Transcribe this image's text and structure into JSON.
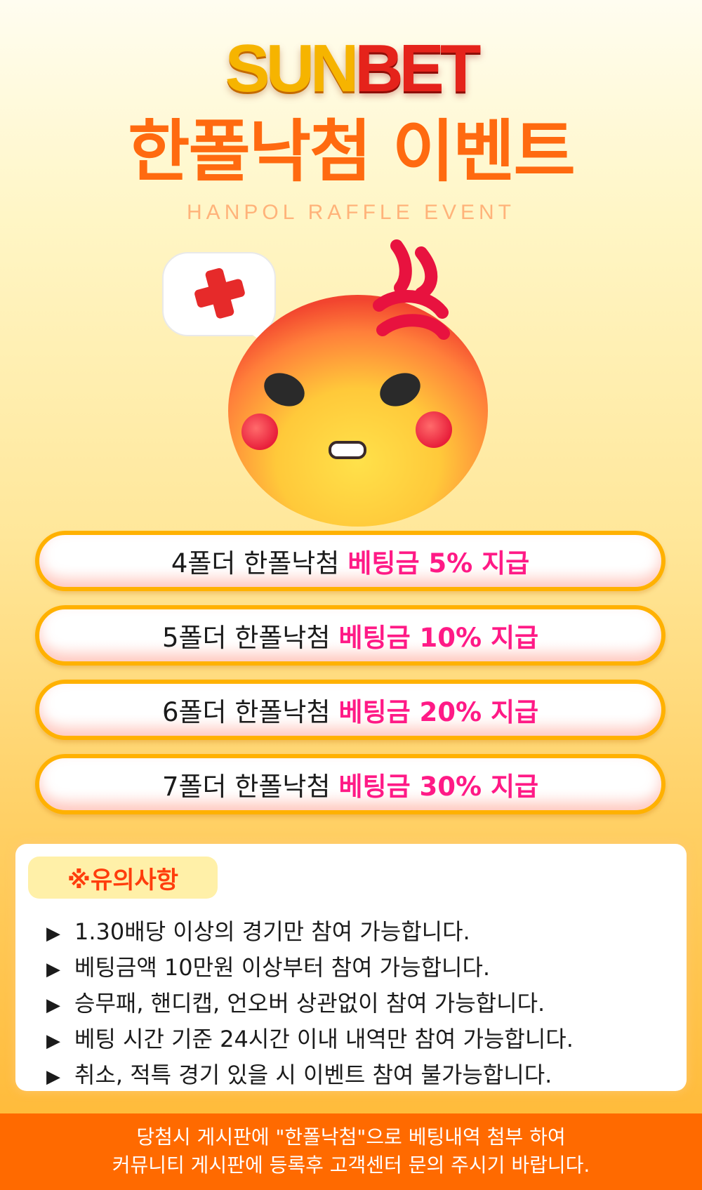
{
  "logo": {
    "part1": "SUN",
    "part2": "BET"
  },
  "title": "한폴낙첨 이벤트",
  "subtitle": "HANPOL RAFFLE EVENT",
  "tiers": [
    {
      "prefix": "4폴더 한폴낙첨",
      "highlight": "베팅금 5% 지급"
    },
    {
      "prefix": "5폴더 한폴낙첨",
      "highlight": "베팅금 10% 지급"
    },
    {
      "prefix": "6폴더 한폴낙첨",
      "highlight": "베팅금 20% 지급"
    },
    {
      "prefix": "7폴더 한폴낙첨",
      "highlight": "베팅금 30% 지급"
    }
  ],
  "notice": {
    "heading": "※유의사항",
    "bullet": "▶",
    "items": [
      "1.30배당 이상의 경기만 참여 가능합니다.",
      "베팅금액 10만원 이상부터 참여 가능합니다.",
      "승무패, 핸디캡, 언오버 상관없이 참여 가능합니다.",
      "베팅 시간 기준 24시간 이내 내역만 참여 가능합니다.",
      "취소, 적특 경기 있을 시 이벤트 참여 불가능합니다."
    ]
  },
  "footer": {
    "line1": "당첨시 게시판에 \"한폴낙첨\"으로 베팅내역 첨부 하여",
    "line2": "커뮤니티 게시판에 등록후 고객센터 문의 주시기 바랍니다."
  },
  "colors": {
    "accent": "#ff6a10",
    "highlight": "#ff1a86",
    "pill_border": "#ffb100",
    "footer_bg": "#ff6a00"
  },
  "icons": [
    "angry-emoji-icon",
    "speech-bubble-icon",
    "red-cross-icon",
    "anger-symbol-icon"
  ]
}
